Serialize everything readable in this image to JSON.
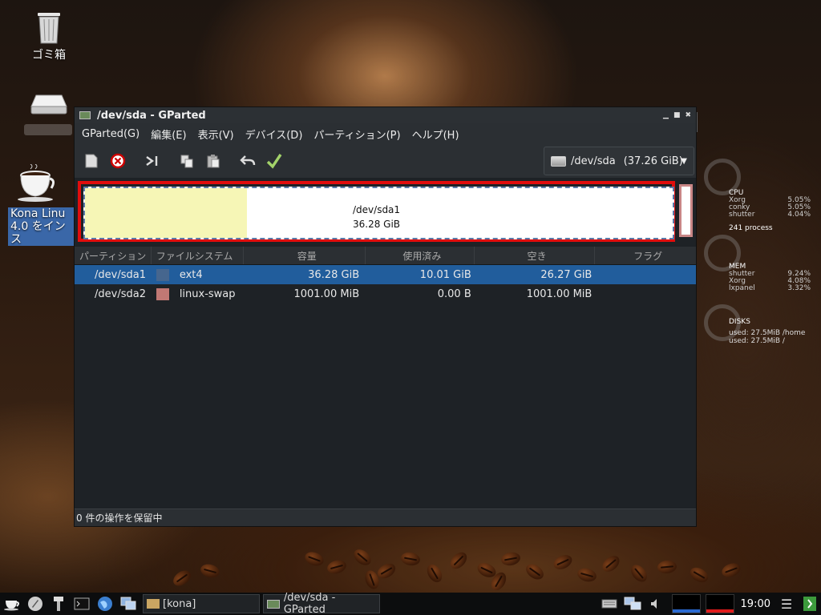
{
  "desktop": {
    "trash_label": "ゴミ箱",
    "kona_label_line1": "Kona Linu",
    "kona_label_line2": "4.0 をインス"
  },
  "window": {
    "title": "/dev/sda - GParted",
    "menu": [
      "GParted(G)",
      "編集(E)",
      "表示(V)",
      "デバイス(D)",
      "パーティション(P)",
      "ヘルプ(H)"
    ],
    "device_selector": {
      "device": "/dev/sda",
      "size": "(37.26 GiB)"
    },
    "disk_map": {
      "selected_partition": "/dev/sda1",
      "selected_size": "36.28 GiB",
      "used_fraction": 0.276
    },
    "table": {
      "headers": [
        "パーティション",
        "ファイルシステム",
        "容量",
        "使用済み",
        "空き",
        "フラグ"
      ],
      "rows": [
        {
          "partition": "/dev/sda1",
          "filesystem": "ext4",
          "fs_color": "#46668e",
          "size": "36.28 GiB",
          "used": "10.01 GiB",
          "free": "26.27 GiB",
          "flags": "",
          "selected": true
        },
        {
          "partition": "/dev/sda2",
          "filesystem": "linux-swap",
          "fs_color": "#c17874",
          "size": "1001.00 MiB",
          "used": "0.00 B",
          "free": "1001.00 MiB",
          "flags": "",
          "selected": false
        }
      ]
    },
    "status": "0 件の操作を保留中"
  },
  "conky": {
    "cpu": {
      "title": "CPU",
      "procs": [
        [
          "Xorg",
          "5.05%"
        ],
        [
          "conky",
          "5.05%"
        ],
        [
          "shutter",
          "4.04%"
        ]
      ],
      "process_count": "241 process"
    },
    "mem": {
      "title": "MEM",
      "procs": [
        [
          "shutter",
          "9.24%"
        ],
        [
          "Xorg",
          "4.08%"
        ],
        [
          "lxpanel",
          "3.32%"
        ]
      ]
    },
    "disks": {
      "title": "DISKS",
      "lines": [
        "used: 27.5MiB /home",
        "used: 27.5MiB /"
      ]
    }
  },
  "taskbar": {
    "folder_task": "[kona]",
    "window_task": "/dev/sda - GParted",
    "clock": "19:00"
  },
  "colors": {
    "accent_selection": "#215d9c",
    "highlight_border": "#e10d0d",
    "used_space": "#f6f6b6"
  }
}
